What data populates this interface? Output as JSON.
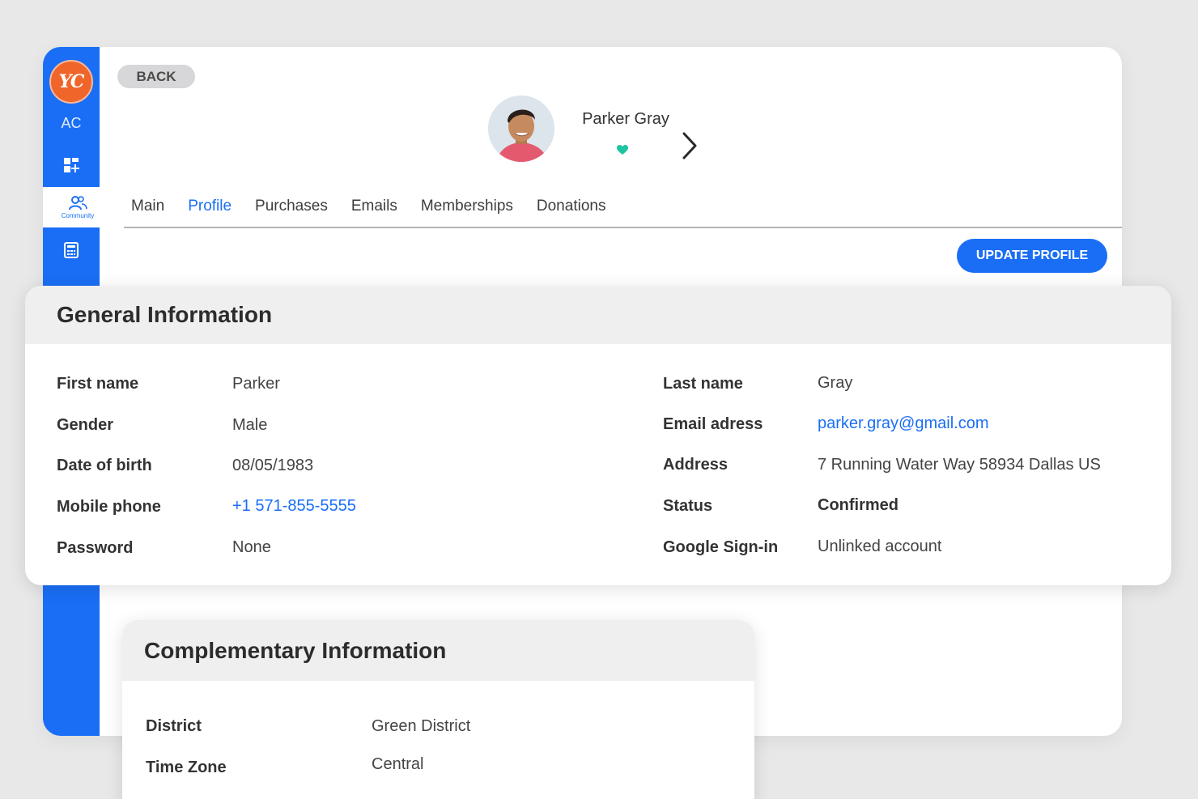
{
  "sidebar": {
    "logo_text": "YC",
    "org_code": "AC",
    "items": [
      {
        "icon": "dashboard-icon"
      },
      {
        "icon": "community-icon",
        "label": "Community",
        "active": true
      },
      {
        "icon": "calculator-icon"
      }
    ]
  },
  "header": {
    "back_label": "BACK",
    "contact_name": "Parker Gray",
    "update_label": "UPDATE PROFILE"
  },
  "tabs": [
    {
      "label": "Main"
    },
    {
      "label": "Profile",
      "active": true
    },
    {
      "label": "Purchases"
    },
    {
      "label": "Emails"
    },
    {
      "label": "Memberships"
    },
    {
      "label": "Donations"
    }
  ],
  "general": {
    "title": "General Information",
    "left": [
      {
        "label": "First name",
        "value": "Parker"
      },
      {
        "label": "Gender",
        "value": "Male"
      },
      {
        "label": "Date of birth",
        "value": "08/05/1983"
      },
      {
        "label": "Mobile phone",
        "value": "+1 571-855-5555"
      },
      {
        "label": "Password",
        "value": "None"
      }
    ],
    "right": [
      {
        "label": "Last name",
        "value": "Gray"
      },
      {
        "label": "Email adress",
        "value": "parker.gray@gmail.com"
      },
      {
        "label": "Address",
        "value": "7 Running Water Way 58934 Dallas US"
      },
      {
        "label": "Status",
        "value": "Confirmed"
      },
      {
        "label": "Google Sign-in",
        "value": "Unlinked account"
      }
    ]
  },
  "complementary": {
    "title": "Complementary Information",
    "rows": [
      {
        "label": "District",
        "value": "Green District"
      },
      {
        "label": "Time Zone",
        "value": "Central"
      }
    ]
  },
  "colors": {
    "accent": "#1a6ef5",
    "logo": "#f0652a",
    "heart": "#1fc4a0"
  }
}
